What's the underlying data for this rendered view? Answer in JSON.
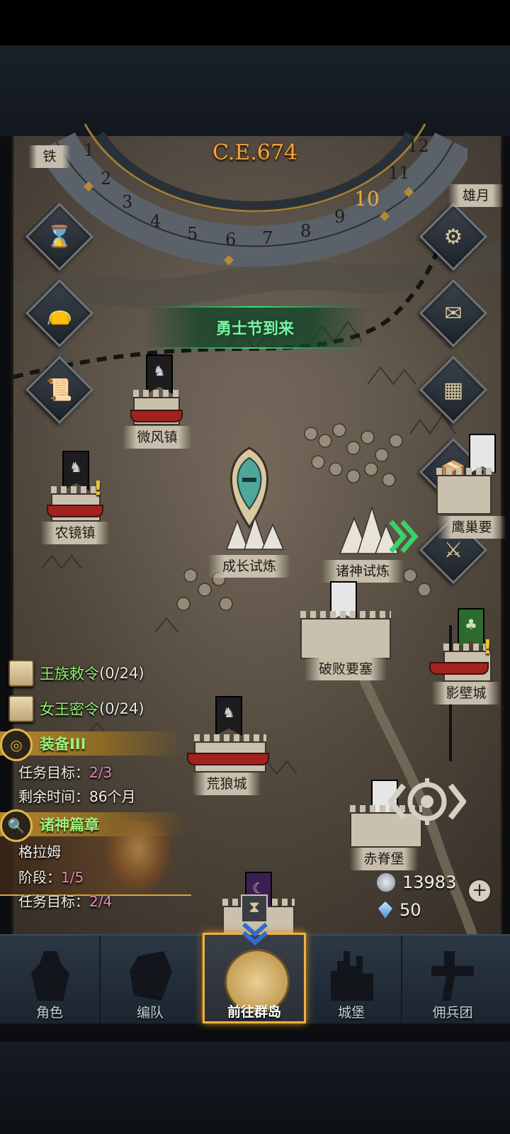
{
  "calendar": {
    "year": "C.E.674",
    "months": [
      "1",
      "2",
      "3",
      "4",
      "5",
      "6",
      "7",
      "8",
      "9",
      "10",
      "11",
      "12"
    ],
    "current_month": "10"
  },
  "event_banner": {
    "text": "勇士节到来"
  },
  "map": {
    "locations": {
      "weifeng": "微风镇",
      "nongjing": "农镜镇",
      "growth_trial": "成长试炼",
      "gods_trial": "诸神试炼",
      "ruined_fortress": "破败要塞",
      "huanglang": "荒狼城",
      "chiji": "赤脊堡",
      "top_left_partial": "铁",
      "top_right_partial": "雄月",
      "right_mid_partial": "鹰巢要",
      "right_partial": "影壁城"
    }
  },
  "side_buttons": {
    "left": [
      "hourglass-icon",
      "bag-icon",
      "scroll-icon"
    ],
    "right": [
      "gear-icon",
      "mail-icon",
      "shop-icon",
      "cargo-icon",
      "warrior-icon"
    ]
  },
  "quests": {
    "royal_order": {
      "label": "王族敕令",
      "progress": "(0/24)"
    },
    "queen_order": {
      "label": "女王密令",
      "progress": "(0/24)"
    },
    "equipment": {
      "title": "装备III",
      "target_label": "任务目标：",
      "target_value": "2/3",
      "time_label": "剩余时间：",
      "time_value": "86个月"
    },
    "gods_chapter": {
      "title": "诸神篇章",
      "character": "格拉姆",
      "stage_label": "阶段：",
      "stage_value": "1/5",
      "target_label": "任务目标：",
      "target_value": "2/4"
    }
  },
  "resources": {
    "silver": "13983",
    "crystal": "50"
  },
  "nav": {
    "items": [
      "角色",
      "编队",
      "前往群岛",
      "城堡",
      "佣兵团"
    ],
    "active_index": 2
  },
  "colors": {
    "accent_gold": "#f0b040",
    "event_green": "#7cf0a6",
    "quest_green": "#8ff06e",
    "progress_pink": "#e88ab3"
  }
}
